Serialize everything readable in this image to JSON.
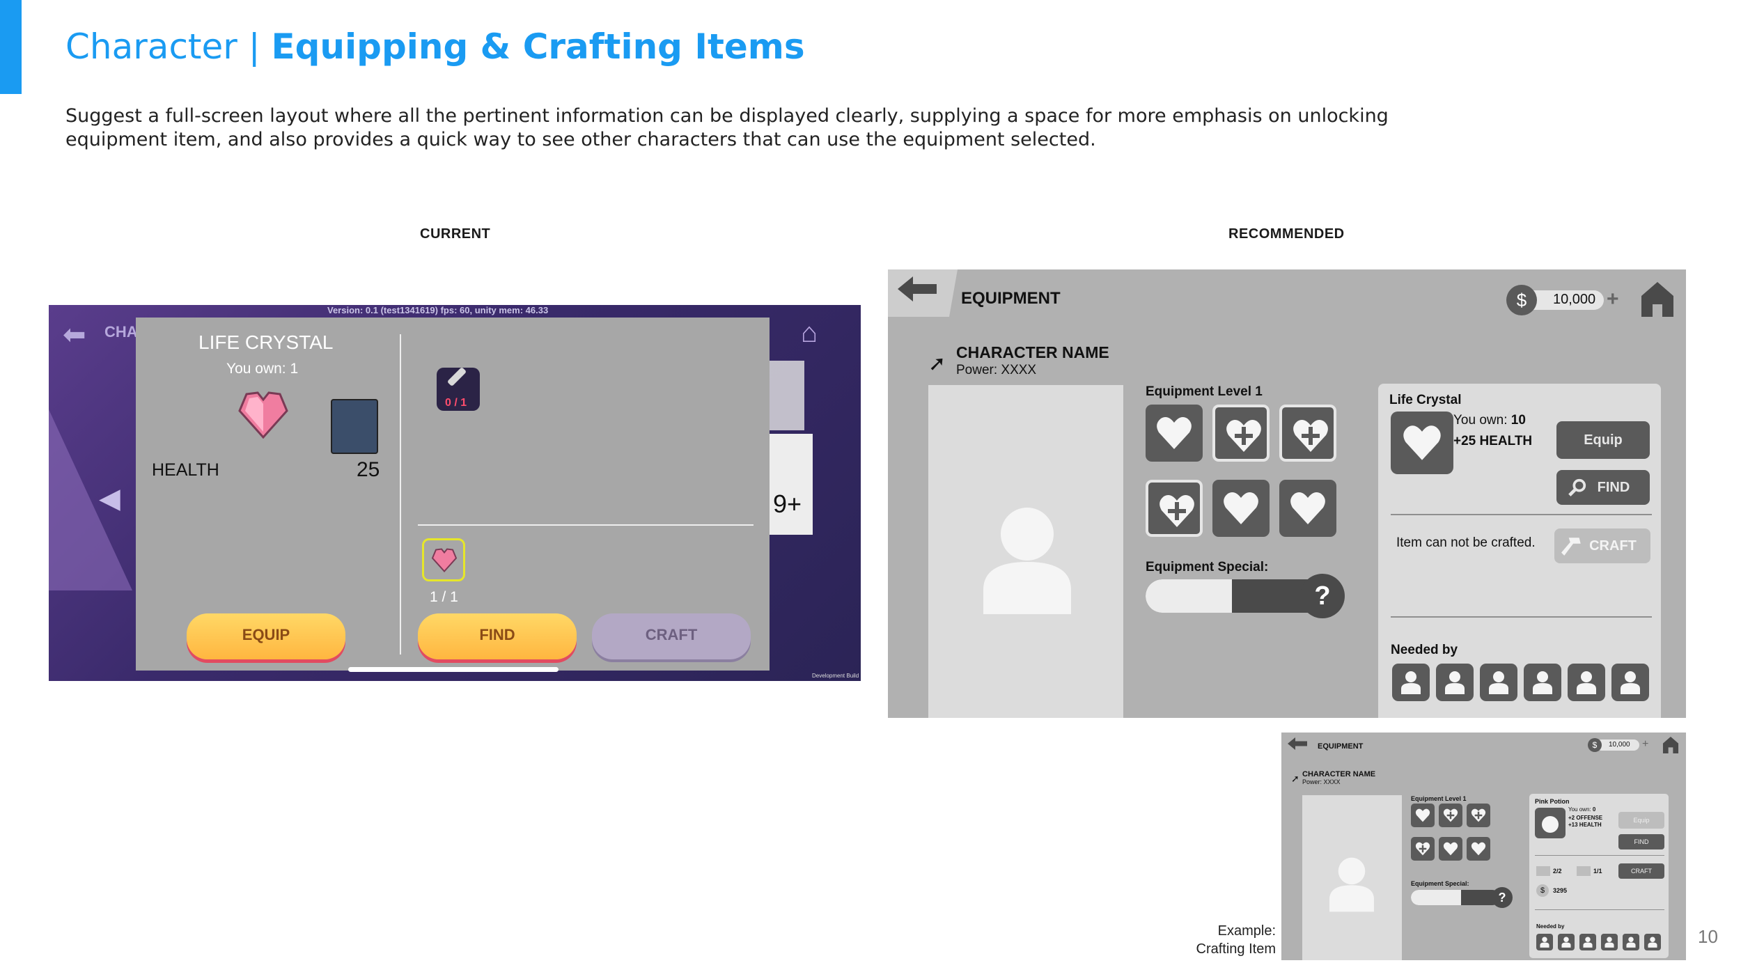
{
  "title": {
    "prefix": "Character | ",
    "bold": "Equipping & Crafting Items"
  },
  "description": "Suggest a full-screen layout where all the pertinent information can be displayed clearly, supplying a space for more emphasis on unlocking equipment item, and also provides a quick way to see other characters that can use the equipment selected.",
  "labels": {
    "current": "CURRENT",
    "recommended": "RECOMMENDED",
    "example": "Example:",
    "example2": "Crafting Item"
  },
  "page_number": "10",
  "current": {
    "topbar": "Version: 0.1 (test1341619)   fps: 60, unity mem: 46.33",
    "back_label": "CHA",
    "item_name": "LIFE CRYSTAL",
    "you_own": "You own: 1",
    "stat_name": "HEALTH",
    "stat_value": "25",
    "sword_count": "0 / 1",
    "gem_count": "1 / 1",
    "equip": "EQUIP",
    "find": "FIND",
    "craft": "CRAFT",
    "side_count": "9+",
    "dev_build": "Development Build"
  },
  "recommended": {
    "header": "EQUIPMENT",
    "currency_symbol": "$",
    "currency": "10,000",
    "character_name": "CHARACTER NAME",
    "power": "Power: XXXX",
    "equipment_level": "Equipment Level 1",
    "equipment_special": "Equipment Special:",
    "special_help": "?",
    "item_name": "Life Crystal",
    "you_own_label": "You own: ",
    "you_own_value": "10",
    "bonus": "+25 HEALTH",
    "equip": "Equip",
    "find": "FIND",
    "not_craftable": "Item can not be crafted.",
    "craft": "CRAFT",
    "needed_by": "Needed by"
  },
  "example": {
    "header": "EQUIPMENT",
    "currency_symbol": "$",
    "currency": "10,000",
    "character_name": "CHARACTER NAME",
    "power": "Power: XXXX",
    "equipment_level": "Equipment Level 1",
    "equipment_special": "Equipment Special:",
    "special_help": "?",
    "item_name": "Pink Potion",
    "you_own_label": "You own: ",
    "you_own_value": "0",
    "bonus1": "+2 OFFENSE",
    "bonus2": "+13 HEALTH",
    "equip": "Equip",
    "find": "FIND",
    "craft": "CRAFT",
    "ing1": "2/2",
    "ing2": "1/1",
    "cost": "3295",
    "needed_by": "Needed by"
  }
}
